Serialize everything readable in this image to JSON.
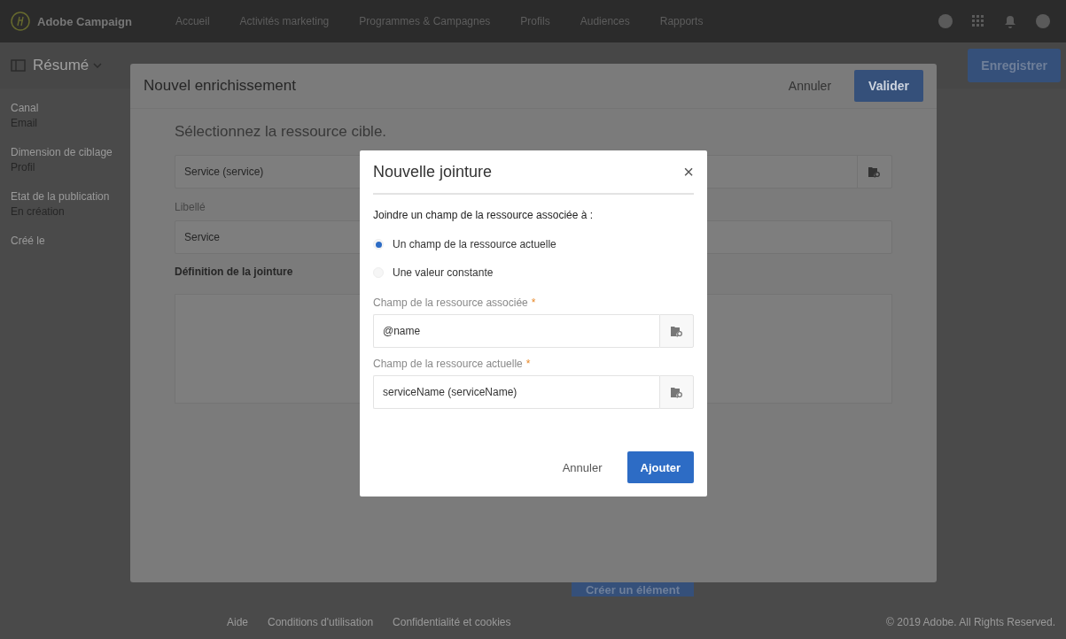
{
  "app": {
    "brand": "Adobe Campaign",
    "nav": [
      "Accueil",
      "Activités marketing",
      "Programmes & Campagnes",
      "Profils",
      "Audiences",
      "Rapports"
    ],
    "page_title": "Résumé",
    "save_button": "Enregistrer",
    "sidebar": [
      {
        "label": "Canal",
        "value": "Email"
      },
      {
        "label": "Dimension de ciblage",
        "value": "Profil"
      },
      {
        "label": "Etat de la publication",
        "value": "En création"
      },
      {
        "label": "Créé le"
      }
    ],
    "create_button": "Créer un élément",
    "footer": {
      "links": [
        "Aide",
        "Conditions d'utilisation",
        "Confidentialité et cookies"
      ],
      "copyright": "© 2019 Adobe. All Rights Reserved."
    }
  },
  "enrichment_modal": {
    "title": "Nouvel enrichissement",
    "cancel": "Annuler",
    "validate": "Valider",
    "heading": "Sélectionnez la ressource cible.",
    "target_value": "Service (service)",
    "label_label": "Libellé",
    "label_value": "Service",
    "join_section": "Définition de la jointure"
  },
  "join_dialog": {
    "title": "Nouvelle jointure",
    "close": "×",
    "prompt": "Joindre un champ de la ressource associée à :",
    "options": [
      {
        "label": "Un champ de la ressource actuelle",
        "selected": true
      },
      {
        "label": "Une valeur constante",
        "selected": false
      }
    ],
    "fields": [
      {
        "label": "Champ de la ressource associée",
        "required_mark": "*",
        "value": "@name"
      },
      {
        "label": "Champ de la ressource actuelle",
        "required_mark": "*",
        "value": "serviceName (serviceName)"
      }
    ],
    "cancel": "Annuler",
    "add": "Ajouter"
  }
}
